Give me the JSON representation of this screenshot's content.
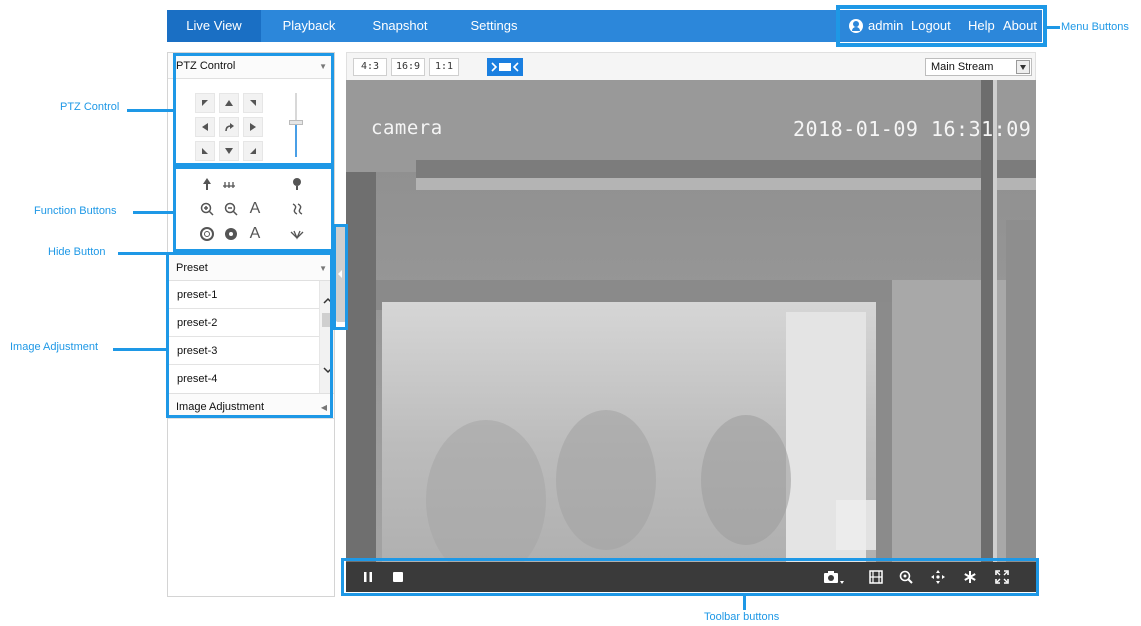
{
  "nav": {
    "tabs": [
      "Live View",
      "Playback",
      "Snapshot",
      "Settings"
    ],
    "active_tab": "Live View",
    "user": "admin",
    "logout": "Logout",
    "help": "Help",
    "about": "About"
  },
  "ptz": {
    "title": "PTZ Control",
    "zoom_level": 0.55
  },
  "preset": {
    "title": "Preset",
    "items": [
      "preset-1",
      "preset-2",
      "preset-3",
      "preset-4"
    ]
  },
  "image_adjustment": {
    "title": "Image Adjustment"
  },
  "aspect_ratios": [
    "4:3",
    "16:9",
    "1:1"
  ],
  "stream": {
    "selected": "Main Stream"
  },
  "video": {
    "osd_name": "camera",
    "osd_time": "2018-01-09 16:31:09"
  },
  "annotations": {
    "menu_buttons": "Menu Buttons",
    "ptz_control": "PTZ Control",
    "function_buttons": "Function Buttons",
    "hide_button": "Hide Button",
    "image_adjustment": "Image Adjustment",
    "toolbar_buttons": "Toolbar buttons"
  },
  "colors": {
    "nav_bg": "#2c87da",
    "nav_active": "#1a6fc4",
    "highlight": "#1e98e6",
    "toolbar_bg": "#3a3a3a"
  }
}
